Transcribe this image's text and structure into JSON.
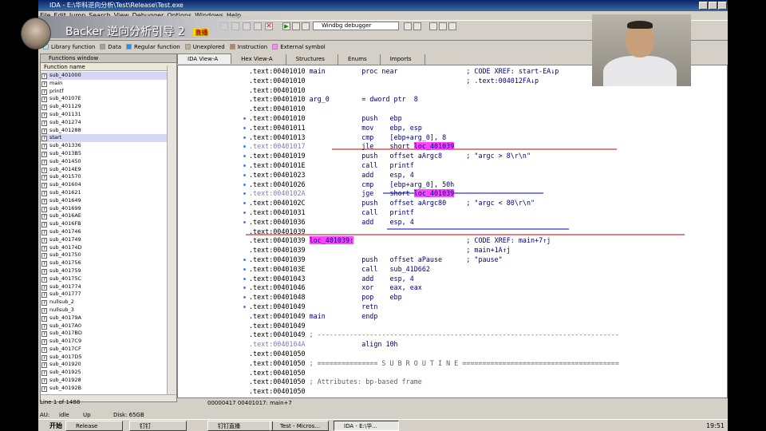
{
  "window": {
    "title": "IDA - E:\\华科逆向分析\\Test\\Release\\Test.exe"
  },
  "menu": [
    "File",
    "Edit",
    "Jump",
    "Search",
    "View",
    "Debugger",
    "Options",
    "Windows",
    "Help"
  ],
  "toolbar": {
    "debugger_select": "Windbg debugger"
  },
  "streamer": {
    "title": "Backer 逆向分析引导 2",
    "badge": "直播"
  },
  "legend": [
    {
      "label": "Library function",
      "color": "#a0e8ff"
    },
    {
      "label": "Data",
      "color": "#a0a0a0"
    },
    {
      "label": "Regular function",
      "color": "#1e90ff"
    },
    {
      "label": "Unexplored",
      "color": "#c0b090"
    },
    {
      "label": "Instruction",
      "color": "#c08060"
    },
    {
      "label": "External symbol",
      "color": "#ff88ff"
    }
  ],
  "functions_window": {
    "title": "Functions window",
    "column": "Function name",
    "items": [
      "sub_401000",
      "main",
      "printf",
      "sub_40107E",
      "sub_401129",
      "sub_401131",
      "sub_401274",
      "sub_401288",
      "start",
      "sub_401336",
      "sub_4013B5",
      "sub_401450",
      "sub_4014E9",
      "sub_401570",
      "sub_401604",
      "sub_401621",
      "sub_401649",
      "sub_401699",
      "sub_4016AE",
      "sub_4016FB",
      "sub_401746",
      "sub_401749",
      "sub_40174D",
      "sub_401750",
      "sub_401756",
      "sub_401759",
      "sub_40175C",
      "sub_401774",
      "sub_401777",
      "nullsub_2",
      "nullsub_3",
      "sub_40179A",
      "sub_4017A0",
      "sub_4017BD",
      "sub_4017C9",
      "sub_4017CF",
      "sub_4017D5",
      "sub_401920",
      "sub_401925",
      "sub_401928",
      "sub_40192B"
    ],
    "line_info": "Line 1 of 1488"
  },
  "tabs": [
    "IDA View-A",
    "Hex View-A",
    "Structures",
    "Enums",
    "Imports"
  ],
  "code_status": "00000417 00401017: main+7",
  "status": {
    "au": "AU:",
    "state": "idle",
    "dir": "Up",
    "disk": "Disk: 65GB"
  },
  "taskbar": {
    "start": "开始",
    "items": [
      "Release",
      "钉钉",
      "钉钉直播",
      "Test - Micros...",
      "IDA - E:\\华..."
    ],
    "clock": "19:51"
  },
  "disasm": [
    {
      "addr": ".text:00401010",
      "label": "main",
      "op": "proc near",
      "args": "",
      "comment": "; CODE XREF: start-EA↓p"
    },
    {
      "addr": ".text:00401010",
      "label": "",
      "op": "",
      "args": "",
      "comment": "; .text:004012FA↓p"
    },
    {
      "addr": ".text:00401010",
      "label": "",
      "op": "",
      "args": "",
      "comment": ""
    },
    {
      "addr": ".text:00401010",
      "label": "arg_0",
      "op": "= dword ptr  8",
      "args": "",
      "comment": ""
    },
    {
      "addr": ".text:00401010",
      "label": "",
      "op": "",
      "args": "",
      "comment": ""
    },
    {
      "addr": ".text:00401010",
      "label": "",
      "op": "push",
      "args": "ebp",
      "comment": ""
    },
    {
      "addr": ".text:00401011",
      "label": "",
      "op": "mov",
      "args": "ebp, esp",
      "comment": ""
    },
    {
      "addr": ".text:00401013",
      "label": "",
      "op": "cmp",
      "args": "[ebp+arg_0], 8",
      "comment": ""
    },
    {
      "addr": ".text:00401017",
      "label": "",
      "op": "jle",
      "args": "short ",
      "target": "loc_401039",
      "comment": ""
    },
    {
      "addr": ".text:00401019",
      "label": "",
      "op": "push",
      "args": "offset aArgc8",
      "comment": "; \"argc > 8\\r\\n\""
    },
    {
      "addr": ".text:0040101E",
      "label": "",
      "op": "call",
      "args": "printf",
      "comment": ""
    },
    {
      "addr": ".text:00401023",
      "label": "",
      "op": "add",
      "args": "esp, 4",
      "comment": ""
    },
    {
      "addr": ".text:00401026",
      "label": "",
      "op": "cmp",
      "args": "[ebp+arg_0], 50h",
      "comment": ""
    },
    {
      "addr": ".text:0040102A",
      "label": "",
      "op": "jge",
      "args": "short ",
      "target": "loc_401039",
      "comment": ""
    },
    {
      "addr": ".text:0040102C",
      "label": "",
      "op": "push",
      "args": "offset aArgc80",
      "comment": "; \"argc < 80\\r\\n\""
    },
    {
      "addr": ".text:00401031",
      "label": "",
      "op": "call",
      "args": "printf",
      "comment": ""
    },
    {
      "addr": ".text:00401036",
      "label": "",
      "op": "add",
      "args": "esp, 4",
      "comment": ""
    },
    {
      "addr": ".text:00401039",
      "label": "",
      "op": "",
      "args": "",
      "comment": ""
    },
    {
      "addr": ".text:00401039",
      "label": "loc_401039:",
      "op": "",
      "args": "",
      "comment": "; CODE XREF: main+7↑j",
      "label_hl": true
    },
    {
      "addr": ".text:00401039",
      "label": "",
      "op": "",
      "args": "",
      "comment": "; main+1A↑j"
    },
    {
      "addr": ".text:00401039",
      "label": "",
      "op": "push",
      "args": "offset aPause",
      "comment": "; \"pause\""
    },
    {
      "addr": ".text:0040103E",
      "label": "",
      "op": "call",
      "args": "sub_41D662",
      "comment": ""
    },
    {
      "addr": ".text:00401043",
      "label": "",
      "op": "add",
      "args": "esp, 4",
      "comment": ""
    },
    {
      "addr": ".text:00401046",
      "label": "",
      "op": "xor",
      "args": "eax, eax",
      "comment": ""
    },
    {
      "addr": ".text:00401048",
      "label": "",
      "op": "pop",
      "args": "ebp",
      "comment": ""
    },
    {
      "addr": ".text:00401049",
      "label": "",
      "op": "retn",
      "args": "",
      "comment": ""
    },
    {
      "addr": ".text:00401049",
      "label": "main",
      "op": "endp",
      "args": "",
      "comment": ""
    },
    {
      "addr": ".text:00401049",
      "label": "",
      "op": "",
      "args": "",
      "comment": ""
    },
    {
      "addr": ".text:00401049",
      "label": "; ---------------------------------------------------------------------------",
      "op": "",
      "args": "",
      "comment": "",
      "raw": true
    },
    {
      "addr": ".text:0040104A",
      "label": "",
      "op": "align 10h",
      "args": "",
      "comment": ""
    },
    {
      "addr": ".text:00401050",
      "label": "",
      "op": "",
      "args": "",
      "comment": ""
    },
    {
      "addr": ".text:00401050",
      "label": "; =============== S U B R O U T I N E =======================================",
      "op": "",
      "args": "",
      "comment": "",
      "raw": true
    },
    {
      "addr": ".text:00401050",
      "label": "",
      "op": "",
      "args": "",
      "comment": ""
    },
    {
      "addr": ".text:00401050",
      "label": "; Attributes: bp-based frame",
      "op": "",
      "args": "",
      "comment": "",
      "raw": true
    },
    {
      "addr": ".text:00401050",
      "label": "",
      "op": "",
      "args": "",
      "comment": ""
    }
  ]
}
